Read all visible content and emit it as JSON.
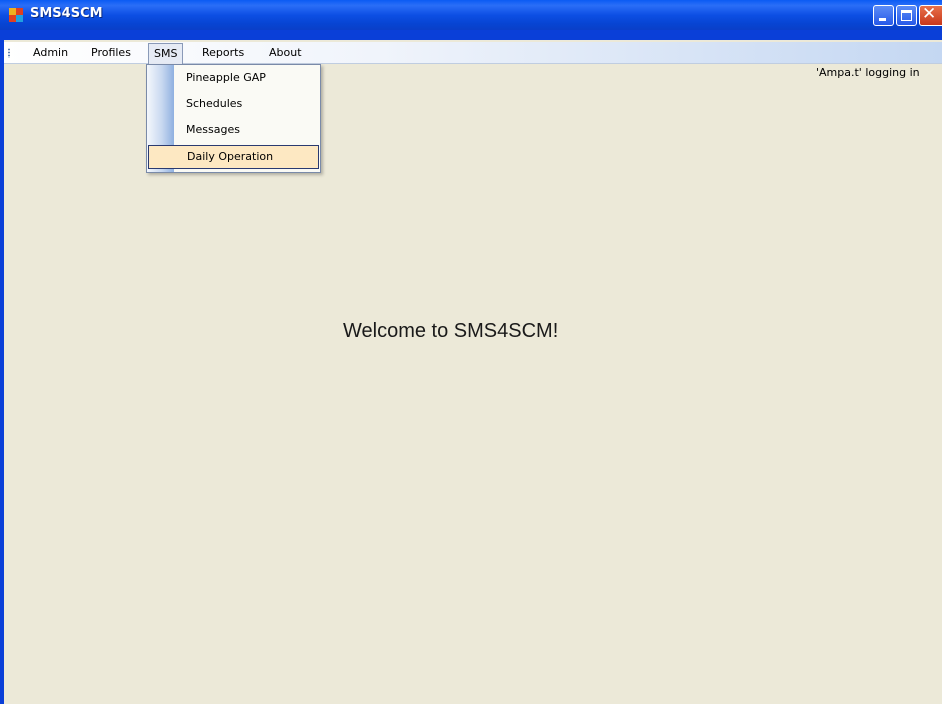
{
  "window": {
    "title": "SMS4SCM",
    "title_bar_color": "#0a4fe4",
    "close_button_color": "#d8502a"
  },
  "menubar": {
    "items": [
      {
        "label": "Admin"
      },
      {
        "label": "Profiles"
      },
      {
        "label": "SMS",
        "state": "open"
      },
      {
        "label": "Reports"
      },
      {
        "label": "About"
      }
    ]
  },
  "sms_menu": {
    "items": [
      {
        "label": "Pineapple GAP"
      },
      {
        "label": "Schedules"
      },
      {
        "label": "Messages"
      },
      {
        "label": "Daily Operation",
        "state": "highlighted"
      }
    ],
    "highlight_color": "#fde8c2"
  },
  "status": {
    "login_text": "'Ampa.t' logging in"
  },
  "main": {
    "welcome_text": "Welcome to SMS4SCM!",
    "background_color": "#ece9d8"
  },
  "icons": {
    "app": "app-icon",
    "minimize": "minimize-icon",
    "maximize": "maximize-icon",
    "close": "close-icon",
    "grip": "grip-icon"
  }
}
